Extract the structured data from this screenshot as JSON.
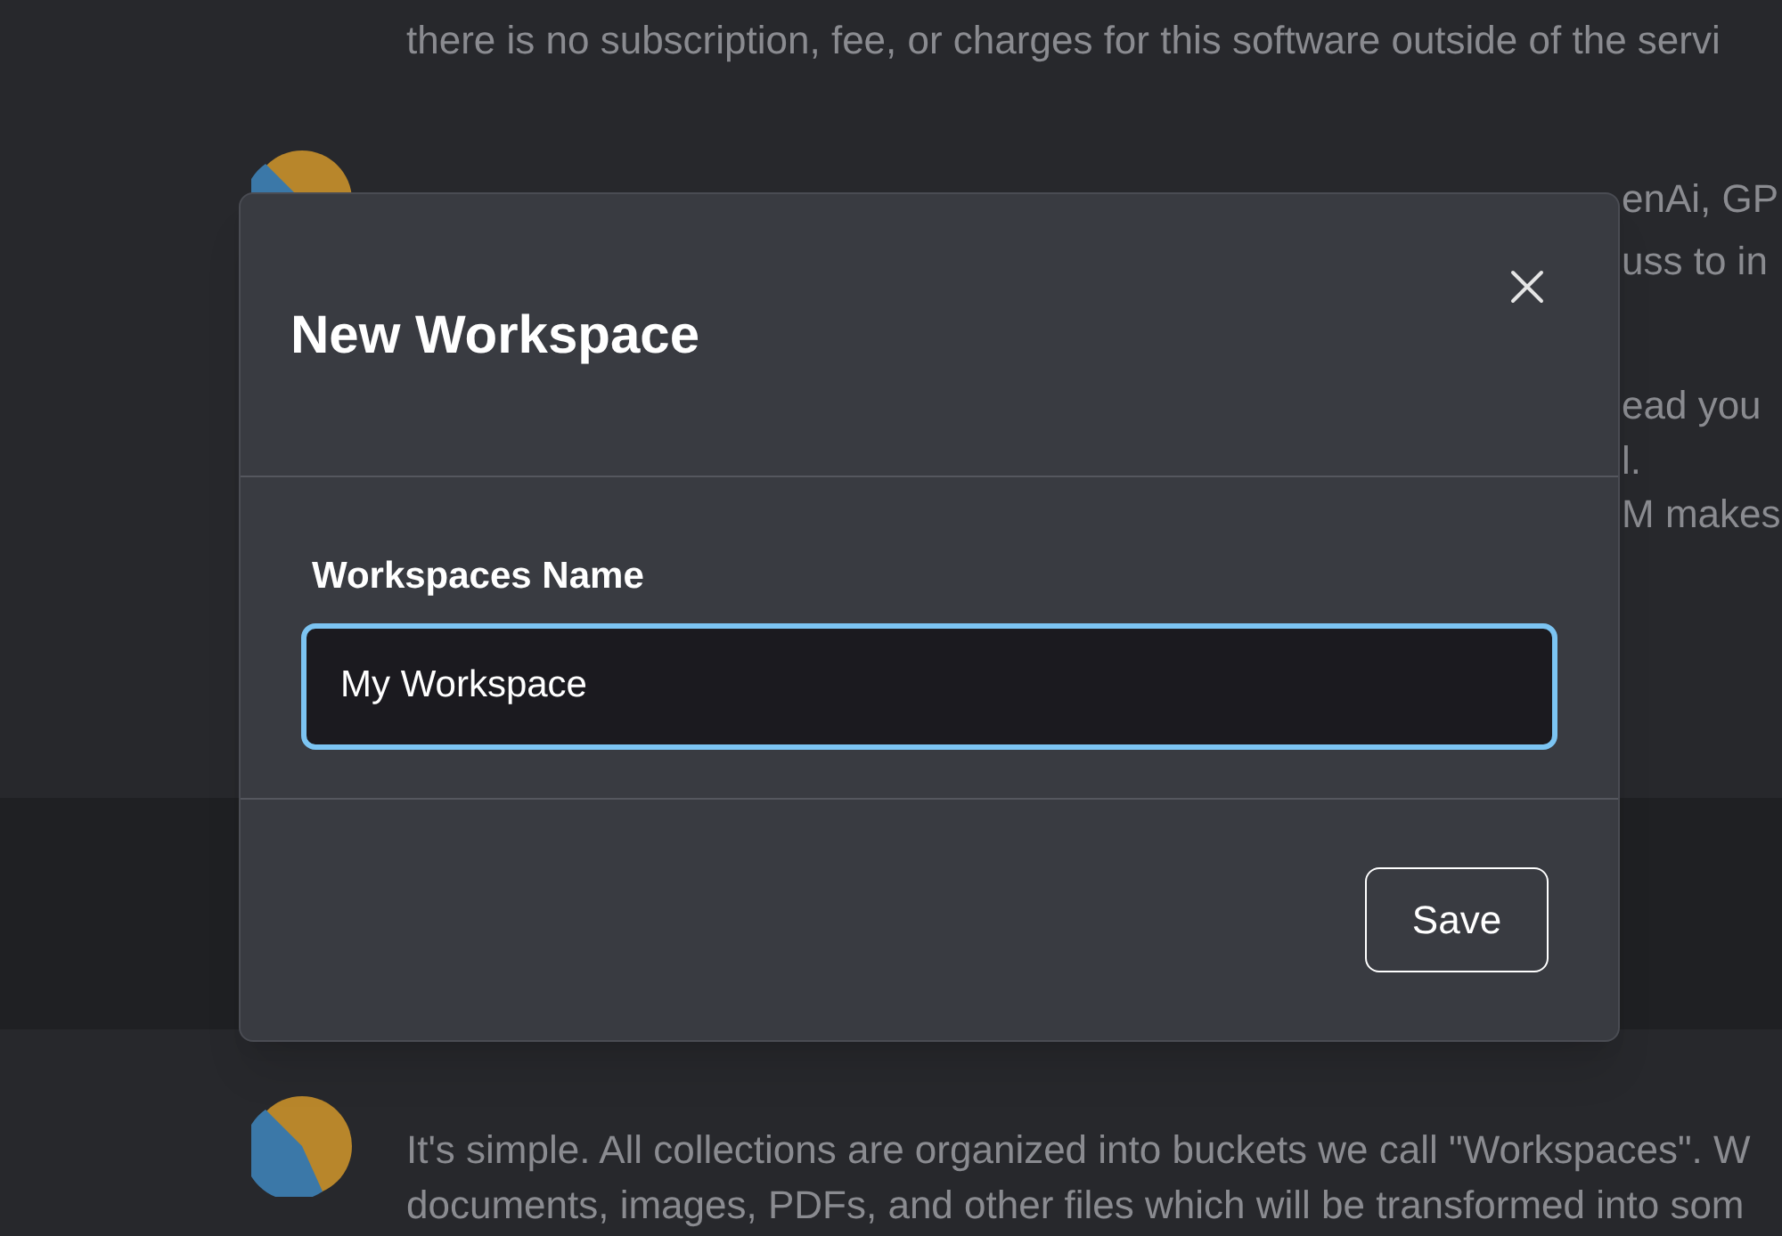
{
  "background_chat": {
    "first_message_lines": [
      "there is no subscription, fee, or charges for this software outside of the servi"
    ],
    "second_message_fragments": [
      "enAi, GP",
      "uss to in",
      "ead you",
      "l.",
      "M makes"
    ],
    "third_message_lines": [
      "It's simple. All collections are organized into buckets we call \"Workspaces\". W",
      "documents, images, PDFs, and other files which will be transformed into som"
    ]
  },
  "dialog": {
    "title": "New Workspace",
    "field_label": "Workspaces Name",
    "field_value": "My Workspace",
    "focused": true,
    "save_button": "Save"
  }
}
